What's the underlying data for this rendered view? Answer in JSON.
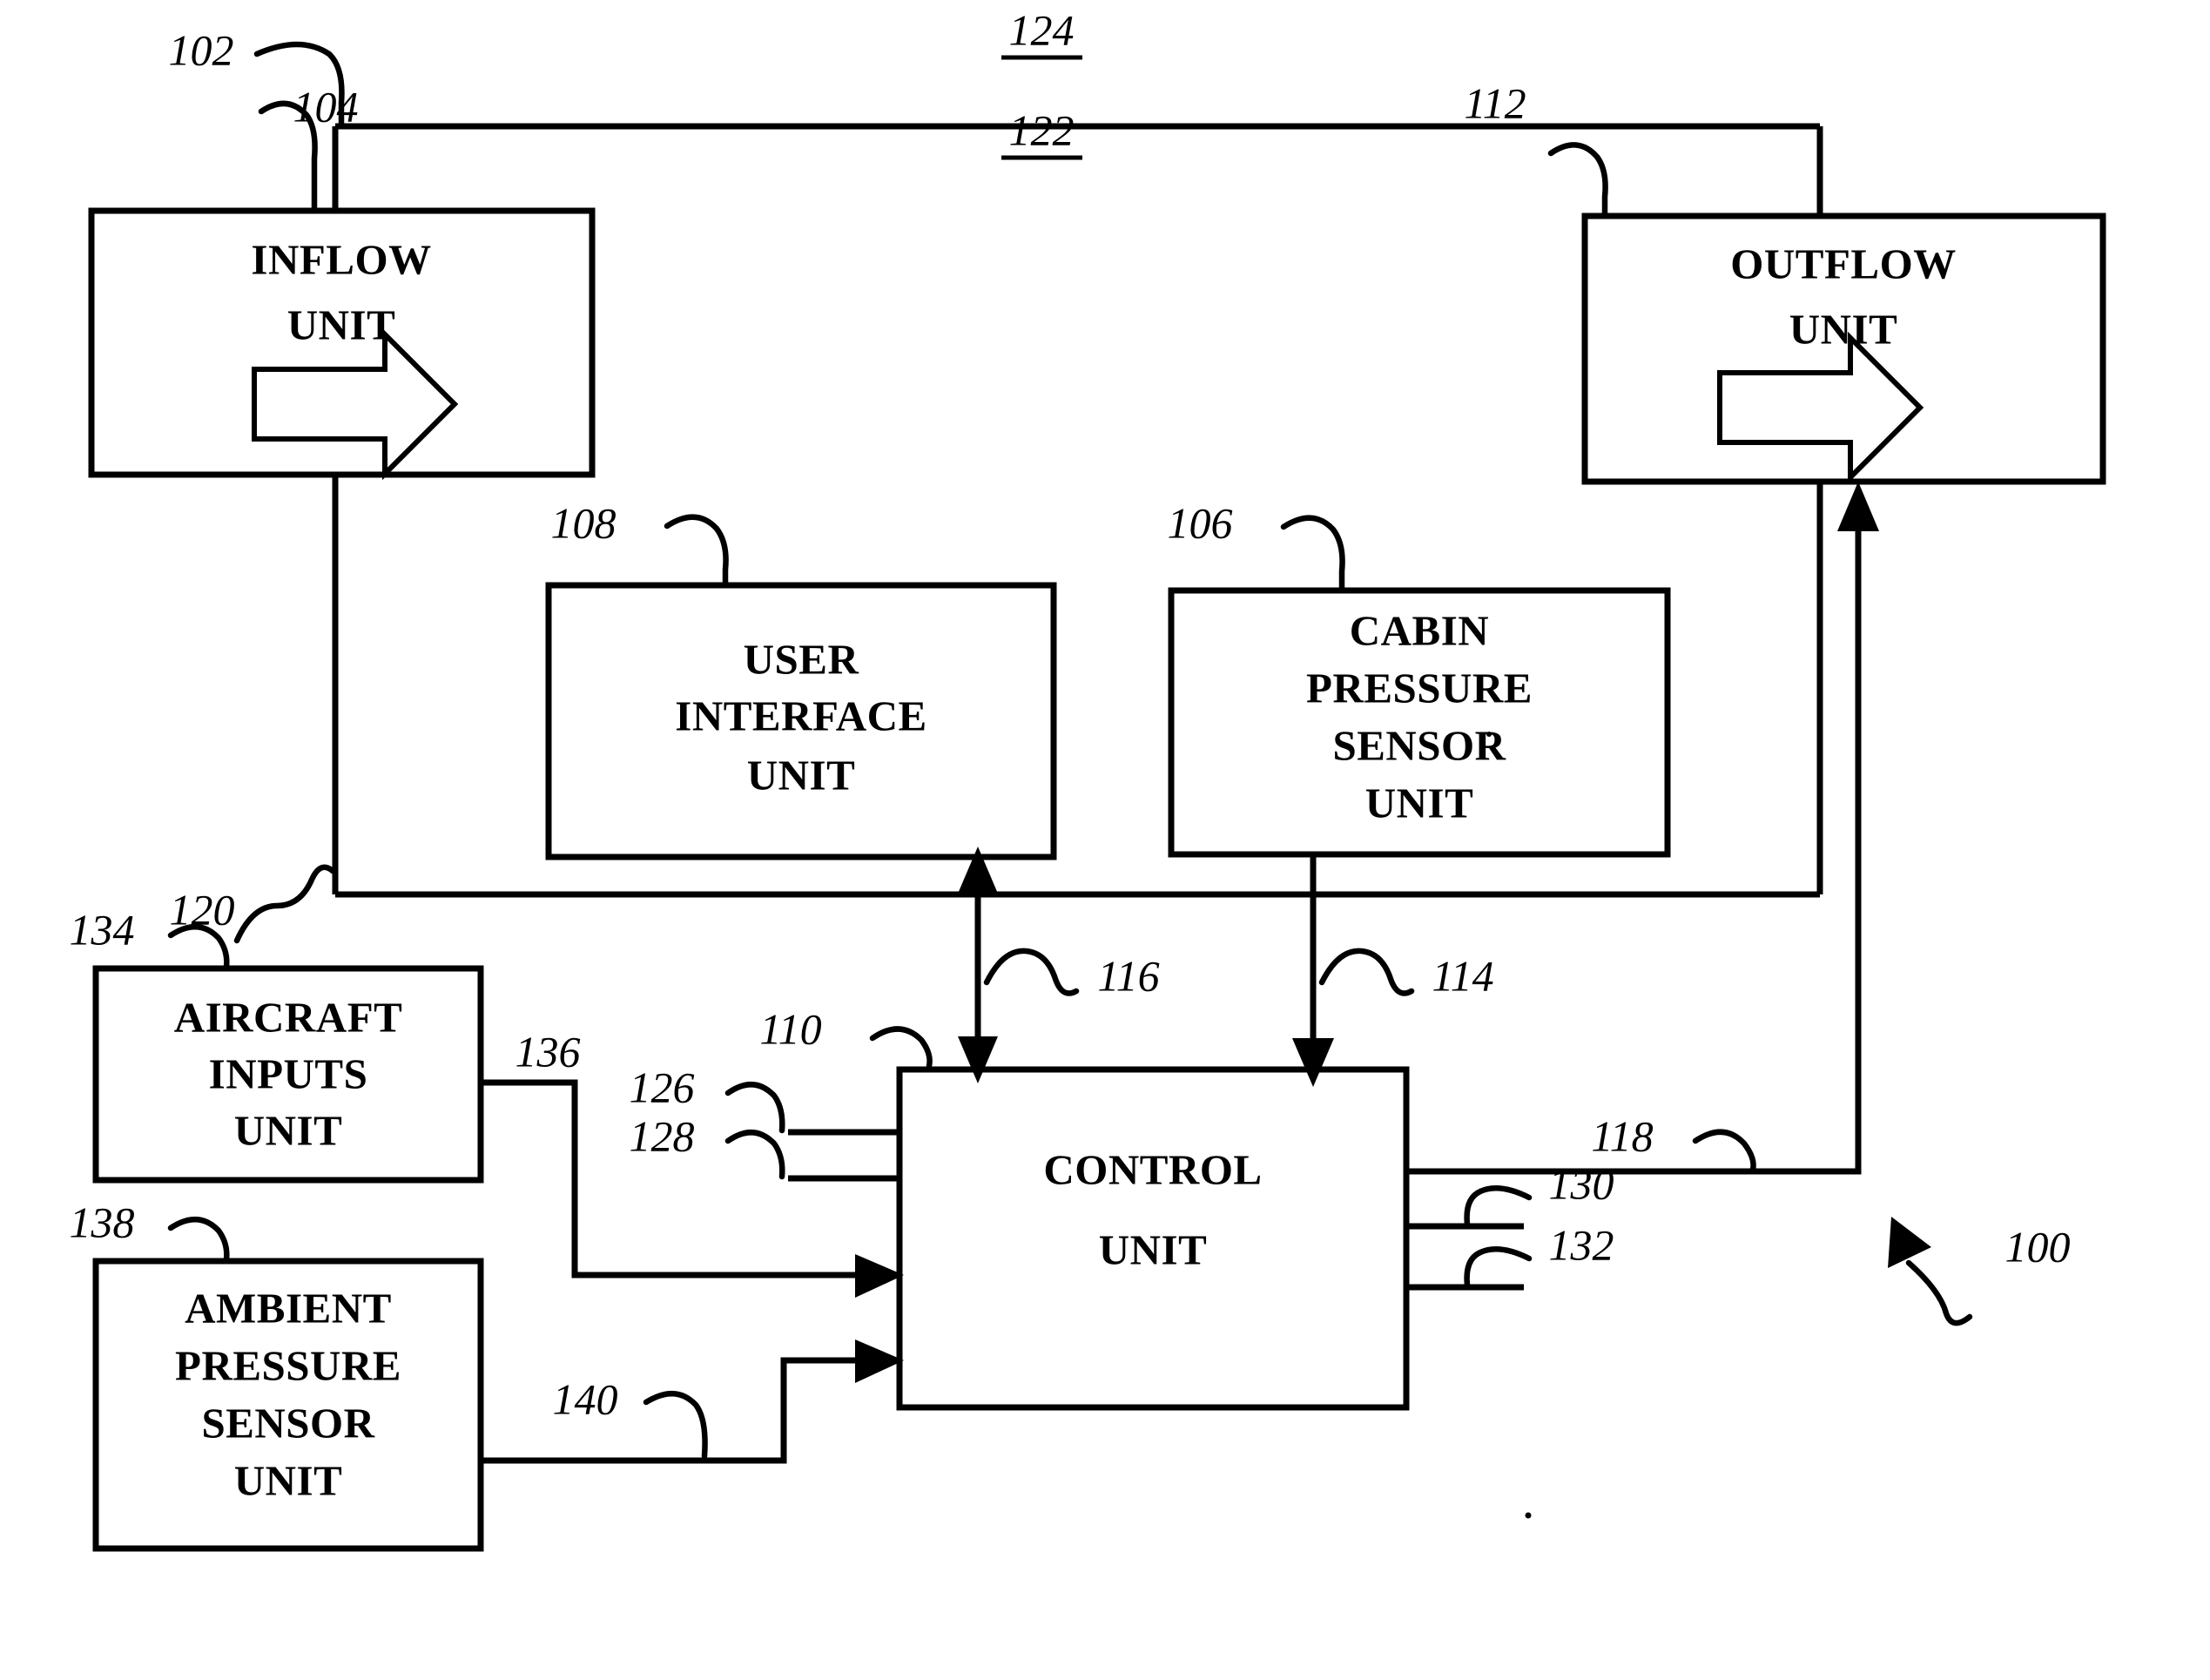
{
  "figure": {
    "title": "Aircraft cabin pressure control system block diagram",
    "system_ref": "100",
    "background_color": "#ffffff",
    "line_color": "#000000"
  },
  "blocks": [
    {
      "id": "inflow",
      "ref": "104",
      "lines": [
        "INFLOW",
        "UNIT"
      ],
      "has_flow_arrow": true
    },
    {
      "id": "outflow",
      "ref": "112",
      "lines": [
        "OUTFLOW",
        "UNIT"
      ],
      "has_flow_arrow": true
    },
    {
      "id": "user_interface",
      "ref": "108",
      "lines": [
        "USER",
        "INTERFACE",
        "UNIT"
      ],
      "has_flow_arrow": false
    },
    {
      "id": "cabin_pressure_sensor",
      "ref": "106",
      "lines": [
        "CABIN",
        "PRESSURE",
        "SENSOR",
        "UNIT"
      ],
      "has_flow_arrow": false
    },
    {
      "id": "control",
      "ref": "110",
      "lines": [
        "CONTROL",
        "UNIT"
      ],
      "has_flow_arrow": false
    },
    {
      "id": "aircraft_inputs",
      "ref": "134",
      "lines": [
        "AIRCRAFT",
        "INPUTS",
        "UNIT"
      ],
      "has_flow_arrow": false
    },
    {
      "id": "ambient_pressure_sensor",
      "ref": "138",
      "lines": [
        "AMBIENT",
        "PRESSURE",
        "SENSOR",
        "UNIT"
      ],
      "has_flow_arrow": false
    }
  ],
  "labels": {
    "inflow_line_1": "INFLOW",
    "inflow_line_2": "UNIT",
    "outflow_line_1": "OUTFLOW",
    "outflow_line_2": "UNIT",
    "ui_line_1": "USER",
    "ui_line_2": "INTERFACE",
    "ui_line_3": "UNIT",
    "cps_line_1": "CABIN",
    "cps_line_2": "PRESSURE",
    "cps_line_3": "SENSOR",
    "cps_line_4": "UNIT",
    "control_line_1": "CONTROL",
    "control_line_2": "UNIT",
    "ai_line_1": "AIRCRAFT",
    "ai_line_2": "INPUTS",
    "ai_line_3": "UNIT",
    "aps_line_1": "AMBIENT",
    "aps_line_2": "PRESSURE",
    "aps_line_3": "SENSOR",
    "aps_line_4": "UNIT"
  },
  "reference_numerals": {
    "n100": "100",
    "n102": "102",
    "n104": "104",
    "n106": "106",
    "n108": "108",
    "n110": "110",
    "n112": "112",
    "n114": "114",
    "n116": "116",
    "n118": "118",
    "n120": "120",
    "n122": "122",
    "n124": "124",
    "n126": "126",
    "n128": "128",
    "n130": "130",
    "n132": "132",
    "n134": "134",
    "n136": "136",
    "n138": "138",
    "n140": "140"
  },
  "underlined_numerals": [
    "122",
    "124"
  ],
  "connections": [
    {
      "ref": "102",
      "from": "duct",
      "to": "inflow-top",
      "type": "plain-line"
    },
    {
      "ref": "124",
      "from": "inflow-top-duct",
      "to": "outflow-top-duct",
      "type": "plain-line"
    },
    {
      "ref": "122",
      "from": "cabin-volume",
      "to": "cabin-volume",
      "type": "plain-line"
    },
    {
      "ref": "120",
      "from": "inflow-bottom",
      "to": "outflow-bottom",
      "type": "plain-line"
    },
    {
      "ref": "116",
      "from": "control",
      "to": "user-interface",
      "type": "double-arrow"
    },
    {
      "ref": "114",
      "from": "cabin-pressure-sensor",
      "to": "control",
      "type": "arrow-down"
    },
    {
      "ref": "118",
      "from": "control",
      "to": "outflow",
      "type": "arrow-up"
    },
    {
      "ref": "136",
      "from": "aircraft-inputs",
      "to": "control",
      "type": "arrow-right"
    },
    {
      "ref": "140",
      "from": "ambient-pressure-sensor",
      "to": "control",
      "type": "arrow-right"
    },
    {
      "ref": "126",
      "from": "external",
      "to": "control",
      "type": "stub-left"
    },
    {
      "ref": "128",
      "from": "external",
      "to": "control",
      "type": "stub-left"
    },
    {
      "ref": "130",
      "from": "control",
      "to": "external",
      "type": "stub-right"
    },
    {
      "ref": "132",
      "from": "control",
      "to": "external",
      "type": "stub-right"
    }
  ]
}
